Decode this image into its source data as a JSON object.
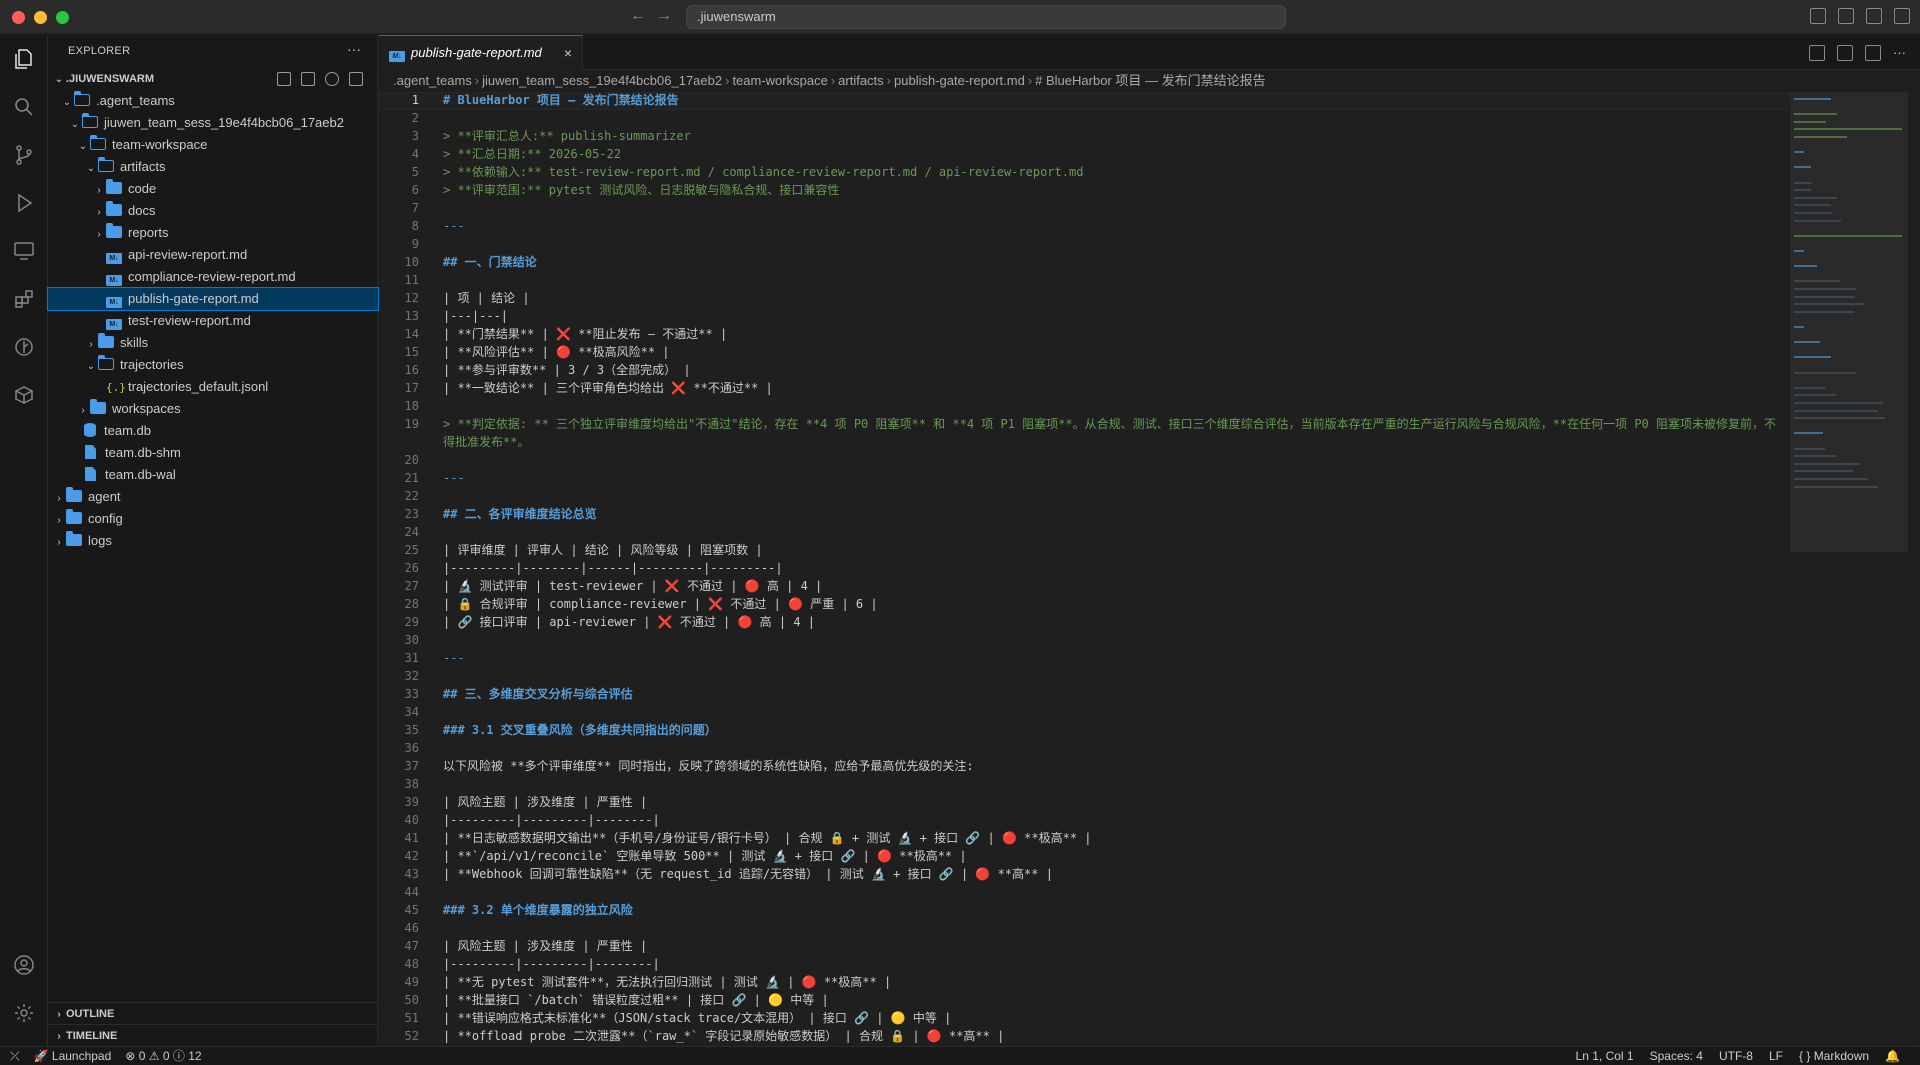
{
  "window": {
    "search_text": ".jiuwenswarm"
  },
  "explorer": {
    "title": "EXPLORER",
    "more": "···",
    "root": ".JIUWENSWARM",
    "tree": [
      {
        "label": ".agent_teams",
        "kind": "folder-open",
        "depth": 1
      },
      {
        "label": "jiuwen_team_sess_19e4f4bcb06_17aeb2",
        "kind": "folder-open",
        "depth": 2
      },
      {
        "label": "team-workspace",
        "kind": "folder-open",
        "depth": 3
      },
      {
        "label": "artifacts",
        "kind": "folder-open",
        "depth": 4
      },
      {
        "label": "code",
        "kind": "folder",
        "depth": 5
      },
      {
        "label": "docs",
        "kind": "folder",
        "depth": 5
      },
      {
        "label": "reports",
        "kind": "folder",
        "depth": 5
      },
      {
        "label": "api-review-report.md",
        "kind": "md",
        "depth": 5
      },
      {
        "label": "compliance-review-report.md",
        "kind": "md",
        "depth": 5
      },
      {
        "label": "publish-gate-report.md",
        "kind": "md",
        "depth": 5,
        "selected": true
      },
      {
        "label": "test-review-report.md",
        "kind": "md",
        "depth": 5
      },
      {
        "label": "skills",
        "kind": "folder",
        "depth": 4
      },
      {
        "label": "trajectories",
        "kind": "folder-open",
        "depth": 4
      },
      {
        "label": "trajectories_default.jsonl",
        "kind": "json",
        "depth": 5
      },
      {
        "label": "workspaces",
        "kind": "folder",
        "depth": 3
      },
      {
        "label": "team.db",
        "kind": "db",
        "depth": 2
      },
      {
        "label": "team.db-shm",
        "kind": "file",
        "depth": 2
      },
      {
        "label": "team.db-wal",
        "kind": "file",
        "depth": 2
      },
      {
        "label": "agent",
        "kind": "folder",
        "depth": 0
      },
      {
        "label": "config",
        "kind": "folder",
        "depth": 0
      },
      {
        "label": "logs",
        "kind": "folder",
        "depth": 0
      }
    ],
    "outline": "OUTLINE",
    "timeline": "TIMELINE"
  },
  "tab": {
    "label": "publish-gate-report.md",
    "close": "×"
  },
  "breadcrumb": [
    ".agent_teams",
    "jiuwen_team_sess_19e4f4bcb06_17aeb2",
    "team-workspace",
    "artifacts",
    "publish-gate-report.md",
    "# BlueHarbor 项目 — 发布门禁结论报告"
  ],
  "editor": {
    "lines": [
      {
        "n": 1,
        "t": "# BlueHarbor 项目 — 发布门禁结论报告",
        "c": "h"
      },
      {
        "n": 2,
        "t": "",
        "c": ""
      },
      {
        "n": 3,
        "t": "> **评审汇总人:** publish-summarizer",
        "c": "q"
      },
      {
        "n": 4,
        "t": "> **汇总日期:** 2026-05-22",
        "c": "q"
      },
      {
        "n": 5,
        "t": "> **依赖输入:** test-review-report.md / compliance-review-report.md / api-review-report.md",
        "c": "q"
      },
      {
        "n": 6,
        "t": "> **评审范围:** pytest 测试风险、日志脱敏与隐私合规、接口兼容性",
        "c": "q"
      },
      {
        "n": 7,
        "t": "",
        "c": ""
      },
      {
        "n": 8,
        "t": "---",
        "c": "hr"
      },
      {
        "n": 9,
        "t": "",
        "c": ""
      },
      {
        "n": 10,
        "t": "## 一、门禁结论",
        "c": "h"
      },
      {
        "n": 11,
        "t": "",
        "c": ""
      },
      {
        "n": 12,
        "t": "| 项 | 结论 |",
        "c": "tbl"
      },
      {
        "n": 13,
        "t": "|---|---|",
        "c": "tbl"
      },
      {
        "n": 14,
        "t": "| **门禁结果** | ❌ **阻止发布 — 不通过** |",
        "c": "tbl"
      },
      {
        "n": 15,
        "t": "| **风险评估** | 🔴 **极高风险** |",
        "c": "tbl"
      },
      {
        "n": 16,
        "t": "| **参与评审数** | 3 / 3（全部完成） |",
        "c": "tbl"
      },
      {
        "n": 17,
        "t": "| **一致结论** | 三个评审角色均给出 ❌ **不通过** |",
        "c": "tbl"
      },
      {
        "n": 18,
        "t": "",
        "c": ""
      },
      {
        "n": 19,
        "t": "> **判定依据: ** 三个独立评审维度均给出\"不通过\"结论，存在 **4 项 P0 阻塞项** 和 **4 项 P1 阻塞项**。从合规、测试、接口三个维度综合评估，当前版本存在严重的生产运行风险与合规风险，**在任何一项 P0 阻塞项未被修复前，不得批准发布**。",
        "c": "q wrap",
        "h": 2
      },
      {
        "n": 20,
        "t": "",
        "c": ""
      },
      {
        "n": 21,
        "t": "---",
        "c": "hr"
      },
      {
        "n": 22,
        "t": "",
        "c": ""
      },
      {
        "n": 23,
        "t": "## 二、各评审维度结论总览",
        "c": "h"
      },
      {
        "n": 24,
        "t": "",
        "c": ""
      },
      {
        "n": 25,
        "t": "| 评审维度 | 评审人 | 结论 | 风险等级 | 阻塞项数 |",
        "c": "tbl"
      },
      {
        "n": 26,
        "t": "|---------|--------|------|---------|---------|",
        "c": "tbl"
      },
      {
        "n": 27,
        "t": "| 🔬 测试评审 | test-reviewer | ❌ 不通过 | 🔴 高 | 4 |",
        "c": "tbl"
      },
      {
        "n": 28,
        "t": "| 🔒 合规评审 | compliance-reviewer | ❌ 不通过 | 🔴 严重 | 6 |",
        "c": "tbl"
      },
      {
        "n": 29,
        "t": "| 🔗 接口评审 | api-reviewer | ❌ 不通过 | 🔴 高 | 4 |",
        "c": "tbl"
      },
      {
        "n": 30,
        "t": "",
        "c": ""
      },
      {
        "n": 31,
        "t": "---",
        "c": "hr"
      },
      {
        "n": 32,
        "t": "",
        "c": ""
      },
      {
        "n": 33,
        "t": "## 三、多维度交叉分析与综合评估",
        "c": "h"
      },
      {
        "n": 34,
        "t": "",
        "c": ""
      },
      {
        "n": 35,
        "t": "### 3.1 交叉重叠风险（多维度共同指出的问题）",
        "c": "h"
      },
      {
        "n": 36,
        "t": "",
        "c": ""
      },
      {
        "n": 37,
        "t": "以下风险被 **多个评审维度** 同时指出，反映了跨领域的系统性缺陷，应给予最高优先级的关注:",
        "c": ""
      },
      {
        "n": 38,
        "t": "",
        "c": ""
      },
      {
        "n": 39,
        "t": "| 风险主题 | 涉及维度 | 严重性 |",
        "c": "tbl"
      },
      {
        "n": 40,
        "t": "|---------|---------|--------|",
        "c": "tbl"
      },
      {
        "n": 41,
        "t": "| **日志敏感数据明文输出**（手机号/身份证号/银行卡号） | 合规 🔒 + 测试 🔬 + 接口 🔗 | 🔴 **极高** |",
        "c": "tbl"
      },
      {
        "n": 42,
        "t": "| **`/api/v1/reconcile` 空账单导致 500** | 测试 🔬 + 接口 🔗 | 🔴 **极高** |",
        "c": "tbl"
      },
      {
        "n": 43,
        "t": "| **Webhook 回调可靠性缺陷**（无 request_id 追踪/无容错） | 测试 🔬 + 接口 🔗 | 🔴 **高** |",
        "c": "tbl"
      },
      {
        "n": 44,
        "t": "",
        "c": ""
      },
      {
        "n": 45,
        "t": "### 3.2 单个维度暴露的独立风险",
        "c": "h"
      },
      {
        "n": 46,
        "t": "",
        "c": ""
      },
      {
        "n": 47,
        "t": "| 风险主题 | 涉及维度 | 严重性 |",
        "c": "tbl"
      },
      {
        "n": 48,
        "t": "|---------|---------|--------|",
        "c": "tbl"
      },
      {
        "n": 49,
        "t": "| **无 pytest 测试套件**，无法执行回归测试 | 测试 🔬 | 🔴 **极高** |",
        "c": "tbl"
      },
      {
        "n": 50,
        "t": "| **批量接口 `/batch` 错误粒度过粗** | 接口 🔗 | 🟡 中等 |",
        "c": "tbl"
      },
      {
        "n": 51,
        "t": "| **错误响应格式未标准化**（JSON/stack trace/文本混用） | 接口 🔗 | 🟡 中等 |",
        "c": "tbl"
      },
      {
        "n": 52,
        "t": "| **offload probe 二次泄露**（`raw_*` 字段记录原始敏感数据） | 合规 🔒 | 🔴 **高** |",
        "c": "tbl"
      }
    ]
  },
  "status": {
    "launchpad": "Launchpad",
    "errors": "0",
    "warnings": "0",
    "info": "12",
    "position": "Ln 1, Col 1",
    "spaces": "Spaces: 4",
    "encoding": "UTF-8",
    "eol": "LF",
    "language": "Markdown"
  }
}
